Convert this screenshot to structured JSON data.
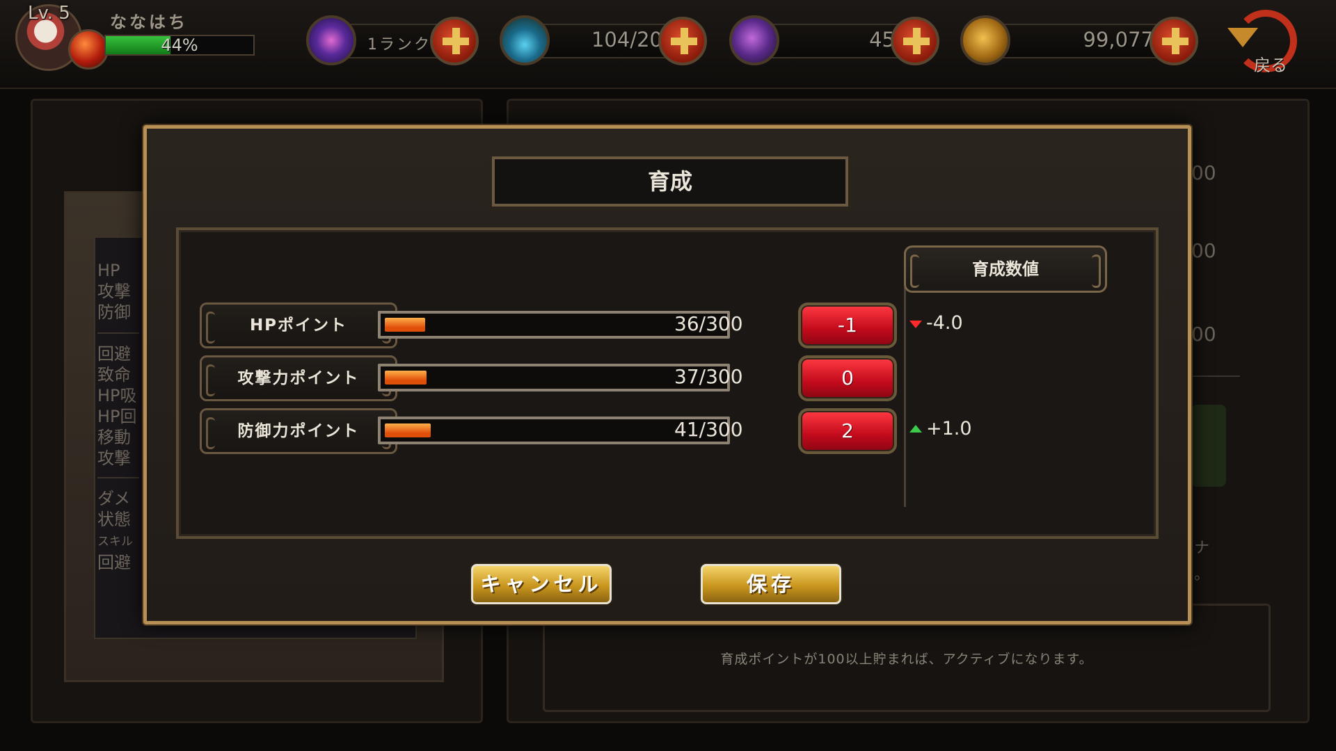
{
  "hud": {
    "level": "Lv. 5",
    "player_name": "ななはち",
    "exp_percent": 44,
    "exp_text": "44%",
    "rank_text": "1ランク",
    "stamina": "104/20",
    "gems": "45",
    "gold": "99,077",
    "back_label": "戻る"
  },
  "background": {
    "stat_labels": [
      "HP",
      "攻撃",
      "防御",
      "回避",
      "致命",
      "HP吸",
      "HP回",
      "移動",
      "攻撃",
      "ダメ",
      "状態",
      "スキル",
      "回避"
    ],
    "right_numbers": [
      "00",
      "00",
      "00"
    ],
    "side_text": [
      "ナ",
      "。"
    ],
    "note": "育成ポイントが100以上貯まれば、アクティブになります。"
  },
  "dialog": {
    "title": "育成",
    "value_header": "育成数値",
    "stats": [
      {
        "label": "HPポイント",
        "current": 36,
        "max": 300,
        "text": "36/300",
        "value": "-1",
        "delta": "-4.0",
        "delta_dir": "down"
      },
      {
        "label": "攻撃力ポイント",
        "current": 37,
        "max": 300,
        "text": "37/300",
        "value": "0",
        "delta": "",
        "delta_dir": "none"
      },
      {
        "label": "防御力ポイント",
        "current": 41,
        "max": 300,
        "text": "41/300",
        "value": "2",
        "delta": "+1.0",
        "delta_dir": "up"
      }
    ],
    "cancel_label": "キャンセル",
    "save_label": "保存"
  },
  "colors": {
    "dialog_border": "#b88f54",
    "bar_fill": "#e04f0a",
    "button_red": "#c20a1c",
    "button_gold": "#c9961e",
    "delta_down": "#ff2a2a",
    "delta_up": "#3acb4a"
  },
  "icons": {
    "rank": "galaxy-orb-icon",
    "stamina": "potion-flask-icon",
    "gems": "purple-gem-icon",
    "gold": "gold-coin-icon",
    "plus": "plus-icon",
    "back": "return-arrow-icon"
  }
}
